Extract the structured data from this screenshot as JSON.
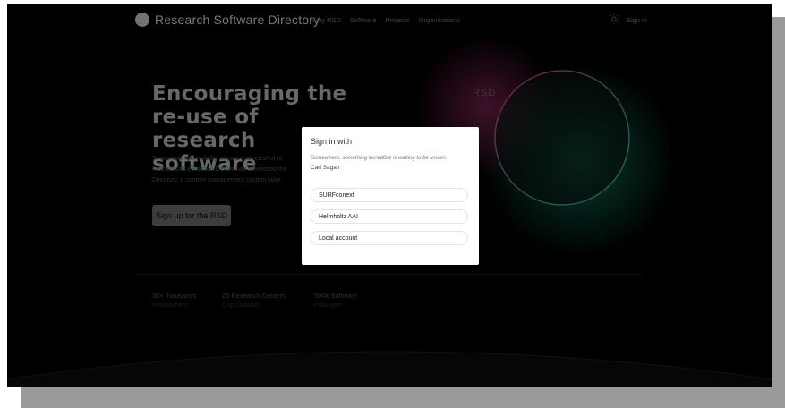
{
  "header": {
    "brand": "Research Software Directory",
    "nav": [
      "Why RSD",
      "Software",
      "Projects",
      "Organisations"
    ],
    "signin": "Sign in",
    "theme_icon": "sun-icon"
  },
  "hero": {
    "title_line1": "Encouraging the",
    "title_line2": "re-use of research",
    "title_line3": "software",
    "text_part1": "To promote the visibility, impact and reuse of re",
    "text_link": "Netherlands eScience Center",
    "text_part2": " has developed the",
    "text_part3": "Directory, a content management system tailor",
    "button": "Sign up for the RSD",
    "logo_text": "RSD"
  },
  "stats": [
    {
      "value": "30+ thousands",
      "label": "Researchers"
    },
    {
      "value": "20 Research Centers",
      "label": "Organisations"
    },
    {
      "value": "500k Software",
      "label": "Packages"
    }
  ],
  "modal": {
    "title": "Sign in with",
    "quote": "Somewhere, something incredible is waiting to be known.",
    "author": "Carl Sagan",
    "providers": [
      "SURFconext",
      "Helmholtz AAI",
      "Local account"
    ]
  },
  "colors": {
    "background": "#000000",
    "accent_green": "#1fc99a",
    "accent_pink": "#d13a8a",
    "modal_bg": "#ffffff"
  }
}
